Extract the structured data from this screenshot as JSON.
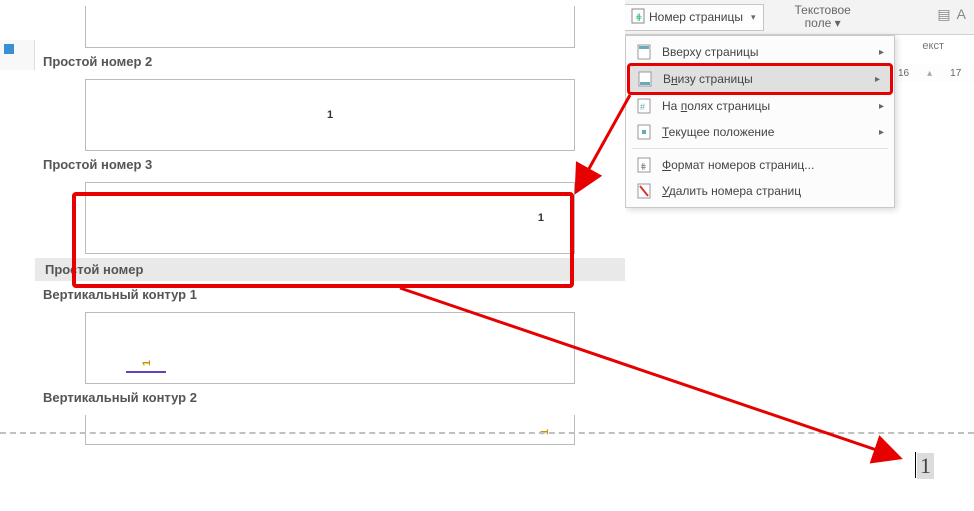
{
  "ribbon": {
    "page_number_button": "Номер страницы",
    "text_field_group_l1": "Текстовое",
    "text_field_group_l2": "поле",
    "text_fragment": "екст"
  },
  "ruler": {
    "n16": "16",
    "n17": "17"
  },
  "dropdown": {
    "top": "Вверху страницы",
    "bottom_prefix": "В",
    "bottom_u": "н",
    "bottom_suffix": "изу страницы",
    "margins_prefix": "На ",
    "margins_u": "п",
    "margins_suffix": "олях страницы",
    "current_prefix": "",
    "current_u": "Т",
    "current_suffix": "екущее положение",
    "format_prefix": "",
    "format_u": "Ф",
    "format_suffix": "ормат номеров страниц...",
    "remove_prefix": "",
    "remove_u": "У",
    "remove_suffix": "далить номера страниц"
  },
  "gallery": {
    "simple2": "Простой номер 2",
    "simple3": "Простой номер 3",
    "section_simple": "Простой номер",
    "vcontour1": "Вертикальный контур 1",
    "vcontour2": "Вертикальный контур 2",
    "pg1": "1"
  },
  "result": {
    "page_number": "1"
  }
}
